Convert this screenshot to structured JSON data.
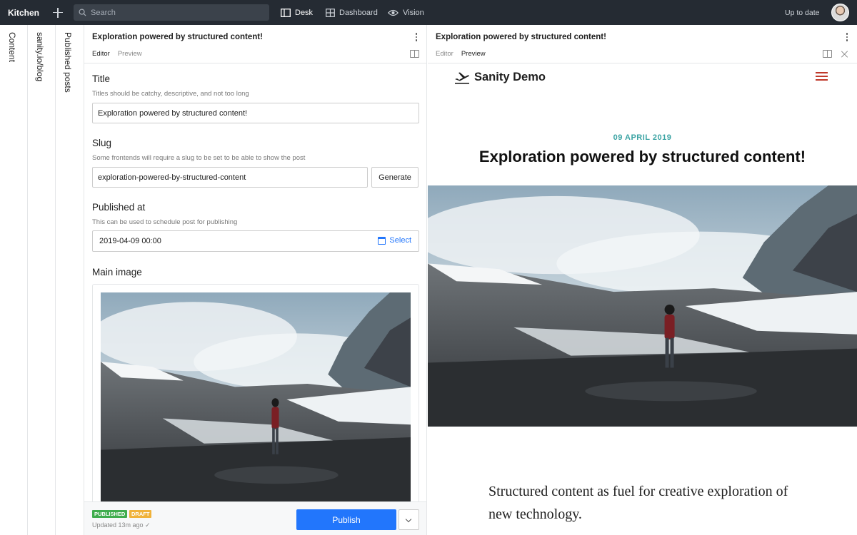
{
  "app": {
    "brand": "Kitchen",
    "search_placeholder": "Search",
    "tools": [
      {
        "label": "Desk",
        "icon": "desk-icon",
        "active": true
      },
      {
        "label": "Dashboard",
        "icon": "dashboard-icon",
        "active": false
      },
      {
        "label": "Vision",
        "icon": "eye-icon",
        "active": false
      }
    ],
    "status": "Up to date"
  },
  "panes": [
    "Content",
    "sanity.io/blog",
    "Published posts"
  ],
  "editor": {
    "title": "Exploration powered by structured content!",
    "tabs": [
      "Editor",
      "Preview"
    ],
    "fields": {
      "title": {
        "label": "Title",
        "hint": "Titles should be catchy, descriptive, and not too long",
        "value": "Exploration powered by structured content!"
      },
      "slug": {
        "label": "Slug",
        "hint": "Some frontends will require a slug to be set to be able to show the post",
        "value": "exploration-powered-by-structured-content",
        "button": "Generate"
      },
      "published_at": {
        "label": "Published at",
        "hint": "This can be used to schedule post for publishing",
        "value": "2019-04-09 00:00",
        "button": "Select"
      },
      "main_image": {
        "label": "Main image"
      }
    },
    "footer": {
      "badges": [
        "PUBLISHED",
        "DRAFT"
      ],
      "updated": "Updated 13m ago ✓",
      "publish": "Publish"
    }
  },
  "preview": {
    "title": "Exploration powered by structured content!",
    "tabs": [
      "Editor",
      "Preview"
    ],
    "site_name": "Sanity Demo",
    "post_date": "09 APRIL 2019",
    "post_title": "Exploration powered by structured content!",
    "lede": "Structured content as fuel for creative exploration of new technology."
  },
  "colors": {
    "accent": "#2276fc",
    "published": "#3fac4d",
    "draft": "#f0b23a",
    "date": "#3aa3a3",
    "menu": "#c0392b"
  }
}
